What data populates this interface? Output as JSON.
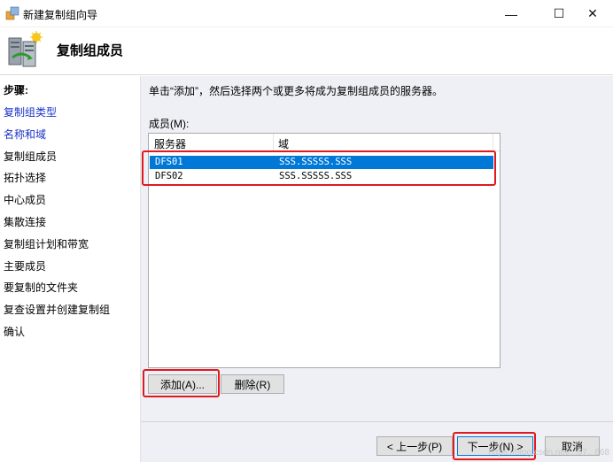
{
  "window": {
    "title": "新建复制组向导",
    "minimize_glyph": "—",
    "maximize_glyph": "☐",
    "close_glyph": "✕"
  },
  "header": {
    "title": "复制组成员"
  },
  "sidebar": {
    "steps_title": "步骤:",
    "items": [
      {
        "label": "复制组类型",
        "state": "link"
      },
      {
        "label": "名称和域",
        "state": "link"
      },
      {
        "label": "复制组成员",
        "state": "current"
      },
      {
        "label": "拓扑选择",
        "state": "pending"
      },
      {
        "label": "中心成员",
        "state": "pending"
      },
      {
        "label": "集散连接",
        "state": "pending"
      },
      {
        "label": "复制组计划和带宽",
        "state": "pending"
      },
      {
        "label": "主要成员",
        "state": "pending"
      },
      {
        "label": "要复制的文件夹",
        "state": "pending"
      },
      {
        "label": "复查设置并创建复制组",
        "state": "pending"
      },
      {
        "label": "确认",
        "state": "pending"
      }
    ]
  },
  "main": {
    "instruction": "单击“添加”，然后选择两个或更多将成为复制组成员的服务器。",
    "members_label": "成员(M):",
    "columns": [
      "服务器",
      "域"
    ],
    "rows": [
      {
        "server": "DFS01",
        "domain": "SSS.SSSSS.SSS",
        "selected": true
      },
      {
        "server": "DFS02",
        "domain": "SSS.SSSSS.SSS",
        "selected": false
      }
    ],
    "add_button": "添加(A)...",
    "remove_button": "删除(R)"
  },
  "footer": {
    "back_button": "< 上一步(P)",
    "next_button": "下一步(N) >",
    "cancel_button": "取消",
    "watermark": "https://blog.csdn.net/...57...668"
  },
  "colors": {
    "link": "#1a33c8",
    "selection": "#0078d7",
    "highlight_box": "#e0191f",
    "panel_bg": "#eef0f5"
  }
}
